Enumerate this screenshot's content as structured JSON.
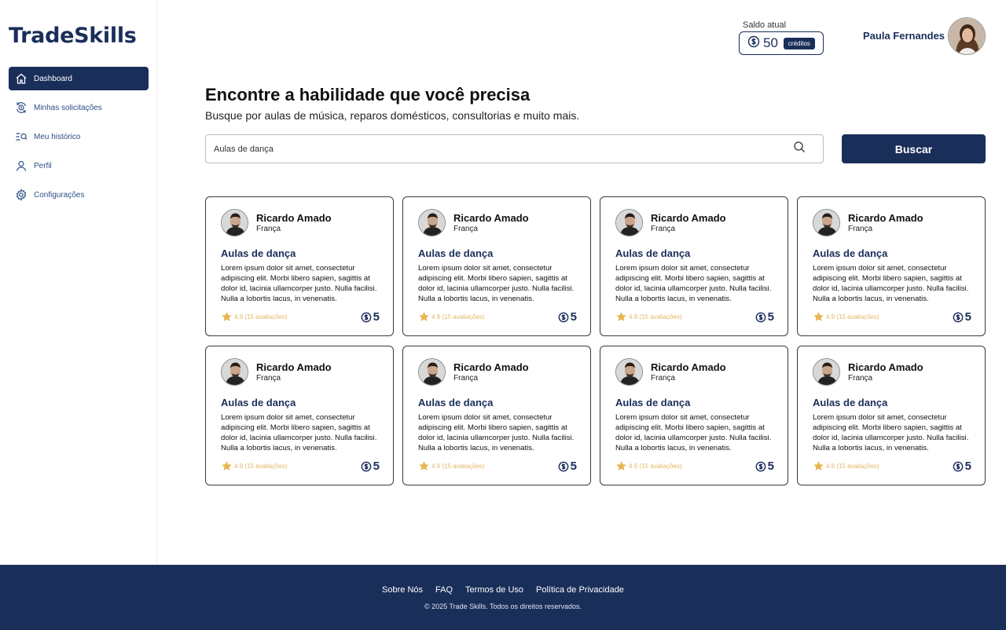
{
  "app": {
    "logo": "TradeSkills"
  },
  "sidebar": {
    "items": [
      {
        "label": "Dashboard",
        "icon": "home-icon",
        "active": true
      },
      {
        "label": "Minhas solicitações",
        "icon": "exchange-coin-icon",
        "active": false
      },
      {
        "label": "Meu histórico",
        "icon": "history-search-icon",
        "active": false
      },
      {
        "label": "Perfil",
        "icon": "user-icon",
        "active": false
      },
      {
        "label": "Configurações",
        "icon": "gear-icon",
        "active": false
      }
    ]
  },
  "header": {
    "balance_label": "Saldo atual",
    "balance_value": "50",
    "balance_unit": "créditos",
    "user_name": "Paula Fernandes"
  },
  "hero": {
    "title": "Encontre a habilidade que você precisa",
    "subtitle": "Busque por aulas de música, reparos domésticos, consultorias e muito mais."
  },
  "search": {
    "value": "Aulas de dança",
    "button_label": "Buscar"
  },
  "cards": [
    {
      "name": "Ricardo Amado",
      "country": "França",
      "skill": "Aulas de dança",
      "description": "Lorem ipsum dolor sit amet, consectetur adipiscing elit. Morbi libero sapien, sagittis at dolor id, lacinia ullamcorper justo. Nulla facilisi. Nulla a lobortis lacus, in venenatis.",
      "rating": "4.9 (15 avaliações)",
      "price": "5"
    },
    {
      "name": "Ricardo Amado",
      "country": "França",
      "skill": "Aulas de dança",
      "description": "Lorem ipsum dolor sit amet, consectetur adipiscing elit. Morbi libero sapien, sagittis at dolor id, lacinia ullamcorper justo. Nulla facilisi. Nulla a lobortis lacus, in venenatis.",
      "rating": "4.9 (15 avaliações)",
      "price": "5"
    },
    {
      "name": "Ricardo Amado",
      "country": "França",
      "skill": "Aulas de dança",
      "description": "Lorem ipsum dolor sit amet, consectetur adipiscing elit. Morbi libero sapien, sagittis at dolor id, lacinia ullamcorper justo. Nulla facilisi. Nulla a lobortis lacus, in venenatis.",
      "rating": "4.9 (15 avaliações)",
      "price": "5"
    },
    {
      "name": "Ricardo Amado",
      "country": "França",
      "skill": "Aulas de dança",
      "description": "Lorem ipsum dolor sit amet, consectetur adipiscing elit. Morbi libero sapien, sagittis at dolor id, lacinia ullamcorper justo. Nulla facilisi. Nulla a lobortis lacus, in venenatis.",
      "rating": "4.9 (15 avaliações)",
      "price": "5"
    },
    {
      "name": "Ricardo Amado",
      "country": "França",
      "skill": "Aulas de dança",
      "description": "Lorem ipsum dolor sit amet, consectetur adipiscing elit. Morbi libero sapien, sagittis at dolor id, lacinia ullamcorper justo. Nulla facilisi. Nulla a lobortis lacus, in venenatis.",
      "rating": "4.9 (15 avaliações)",
      "price": "5"
    },
    {
      "name": "Ricardo Amado",
      "country": "França",
      "skill": "Aulas de dança",
      "description": "Lorem ipsum dolor sit amet, consectetur adipiscing elit. Morbi libero sapien, sagittis at dolor id, lacinia ullamcorper justo. Nulla facilisi. Nulla a lobortis lacus, in venenatis.",
      "rating": "4.9 (15 avaliações)",
      "price": "5"
    },
    {
      "name": "Ricardo Amado",
      "country": "França",
      "skill": "Aulas de dança",
      "description": "Lorem ipsum dolor sit amet, consectetur adipiscing elit. Morbi libero sapien, sagittis at dolor id, lacinia ullamcorper justo. Nulla facilisi. Nulla a lobortis lacus, in venenatis.",
      "rating": "4.9 (15 avaliações)",
      "price": "5"
    },
    {
      "name": "Ricardo Amado",
      "country": "França",
      "skill": "Aulas de dança",
      "description": "Lorem ipsum dolor sit amet, consectetur adipiscing elit. Morbi libero sapien, sagittis at dolor id, lacinia ullamcorper justo. Nulla facilisi. Nulla a lobortis lacus, in venenatis.",
      "rating": "4.9 (15 avaliações)",
      "price": "5"
    }
  ],
  "footer": {
    "links": [
      "Sobre Nós",
      "FAQ",
      "Termos de Uso",
      "Política de Privacidade"
    ],
    "copyright": "© 2025 Trade Skills. Todos os direitos reservados."
  },
  "colors": {
    "brand": "#1a2e5a",
    "nav_text": "#2c4f84",
    "rating": "#e3b866"
  }
}
